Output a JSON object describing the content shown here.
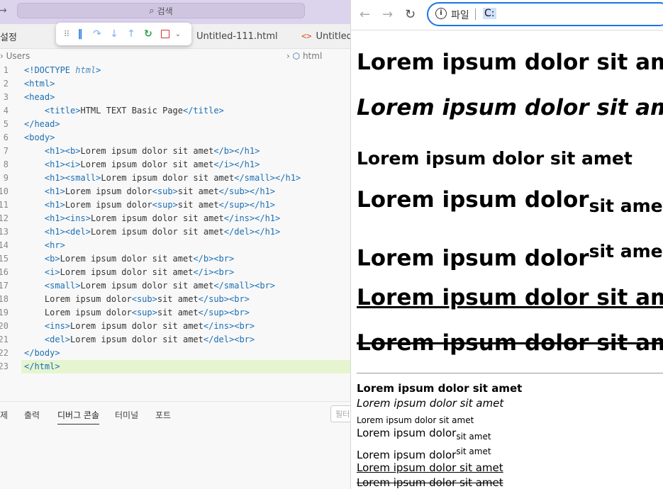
{
  "editor": {
    "command_center": "검색",
    "settings_tab": "설정",
    "tabs": [
      {
        "label": "Untitled-111.html"
      },
      {
        "label": "Untitled-"
      }
    ],
    "breadcrumb": {
      "folder": "Users",
      "file": "html"
    },
    "code_lines": [
      {
        "n": "1",
        "html": "<span class=\"t\">&lt;!DOCTYPE</span> <span class=\"it\">html</span><span class=\"t\">&gt;</span>"
      },
      {
        "n": "2",
        "html": "<span class=\"t\">&lt;html&gt;</span>"
      },
      {
        "n": "3",
        "html": "<span class=\"t\">&lt;head&gt;</span>"
      },
      {
        "n": "4",
        "html": "    <span class=\"t\">&lt;title&gt;</span>HTML TEXT Basic Page<span class=\"t\">&lt;/title&gt;</span>"
      },
      {
        "n": "5",
        "html": "<span class=\"t\">&lt;/head&gt;</span>"
      },
      {
        "n": "6",
        "html": "<span class=\"t\">&lt;body&gt;</span>"
      },
      {
        "n": "7",
        "html": "    <span class=\"t\">&lt;h1&gt;&lt;b&gt;</span>Lorem ipsum dolor sit amet<span class=\"t\">&lt;/b&gt;&lt;/h1&gt;</span>"
      },
      {
        "n": "8",
        "html": "    <span class=\"t\">&lt;h1&gt;&lt;i&gt;</span>Lorem ipsum dolor sit amet<span class=\"t\">&lt;/i&gt;&lt;/h1&gt;</span>"
      },
      {
        "n": "9",
        "html": "    <span class=\"t\">&lt;h1&gt;&lt;small&gt;</span>Lorem ipsum dolor sit amet<span class=\"t\">&lt;/small&gt;&lt;/h1&gt;</span>"
      },
      {
        "n": "10",
        "html": "    <span class=\"t\">&lt;h1&gt;</span>Lorem ipsum dolor<span class=\"t\">&lt;sub&gt;</span>sit amet<span class=\"t\">&lt;/sub&gt;&lt;/h1&gt;</span>"
      },
      {
        "n": "11",
        "html": "    <span class=\"t\">&lt;h1&gt;</span>Lorem ipsum dolor<span class=\"t\">&lt;sup&gt;</span>sit amet<span class=\"t\">&lt;/sup&gt;&lt;/h1&gt;</span>"
      },
      {
        "n": "12",
        "html": "    <span class=\"t\">&lt;h1&gt;&lt;ins&gt;</span>Lorem ipsum dolor sit amet<span class=\"t\">&lt;/ins&gt;&lt;/h1&gt;</span>"
      },
      {
        "n": "13",
        "html": "    <span class=\"t\">&lt;h1&gt;&lt;del&gt;</span>Lorem ipsum dolor sit amet<span class=\"t\">&lt;/del&gt;&lt;/h1&gt;</span>"
      },
      {
        "n": "14",
        "html": "    <span class=\"t\">&lt;hr&gt;</span>"
      },
      {
        "n": "15",
        "html": "    <span class=\"t\">&lt;b&gt;</span>Lorem ipsum dolor sit amet<span class=\"t\">&lt;/b&gt;&lt;br&gt;</span>"
      },
      {
        "n": "16",
        "html": "    <span class=\"t\">&lt;i&gt;</span>Lorem ipsum dolor sit amet<span class=\"t\">&lt;/i&gt;&lt;br&gt;</span>"
      },
      {
        "n": "17",
        "html": "    <span class=\"t\">&lt;small&gt;</span>Lorem ipsum dolor sit amet<span class=\"t\">&lt;/small&gt;&lt;br&gt;</span>"
      },
      {
        "n": "18",
        "html": "    Lorem ipsum dolor<span class=\"t\">&lt;sub&gt;</span>sit amet<span class=\"t\">&lt;/sub&gt;&lt;br&gt;</span>"
      },
      {
        "n": "19",
        "html": "    Lorem ipsum dolor<span class=\"t\">&lt;sup&gt;</span>sit amet<span class=\"t\">&lt;/sup&gt;&lt;br&gt;</span>"
      },
      {
        "n": "20",
        "html": "    <span class=\"t\">&lt;ins&gt;</span>Lorem ipsum dolor sit amet<span class=\"t\">&lt;/ins&gt;&lt;br&gt;</span>"
      },
      {
        "n": "21",
        "html": "    <span class=\"t\">&lt;del&gt;</span>Lorem ipsum dolor sit amet<span class=\"t\">&lt;/del&gt;&lt;br&gt;</span>"
      },
      {
        "n": "22",
        "html": "<span class=\"t\">&lt;/body&gt;</span>"
      },
      {
        "n": "23",
        "html": "<span class=\"t\">&lt;/html&gt;</span>"
      }
    ],
    "active_line": 23,
    "panel_tabs": [
      "제",
      "출력",
      "디버그 콘솔",
      "터미널",
      "포트"
    ],
    "active_panel_tab": 2,
    "filter_placeholder": "필터"
  },
  "browser": {
    "scheme_label": "파일",
    "url": "C:",
    "h1_text": "Lorem ipsum dolor sit amet",
    "h1_base": "Lorem ipsum dolor",
    "h1_script": "sit amet",
    "body_text": "Lorem ipsum dolor sit amet",
    "body_base": "Lorem ipsum dolor",
    "body_script": "sit amet"
  },
  "colors": {
    "accent": "#1a73e8",
    "tag": "#1a6fb5",
    "html_icon": "#e44d26",
    "titlebar": "#dcd3ec",
    "active_line": "#e6f5d0"
  }
}
